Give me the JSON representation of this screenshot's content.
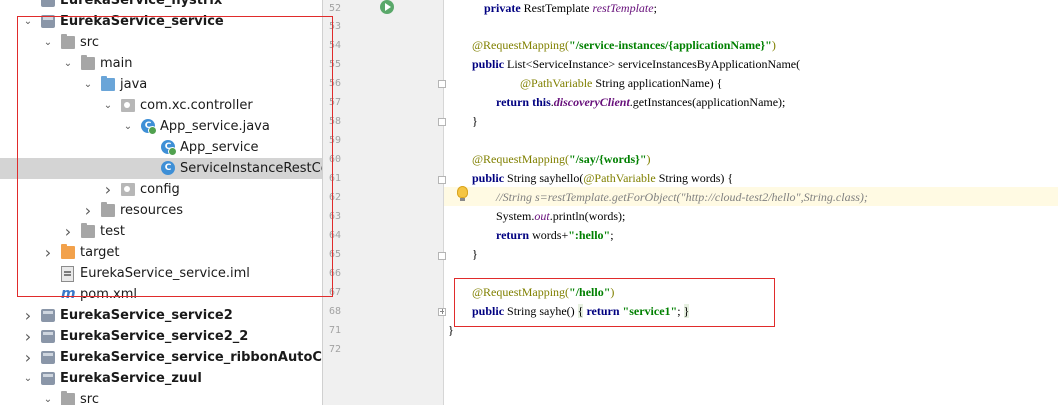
{
  "project_tree": {
    "items": [
      {
        "label": "EurekaService_hystrix",
        "bold": true,
        "arrow": "",
        "icon": "module-icon",
        "level": 0
      },
      {
        "label": "EurekaService_service",
        "bold": true,
        "arrow": "expanded",
        "icon": "module-icon",
        "level": 0
      },
      {
        "label": "src",
        "arrow": "expanded",
        "icon": "folder-icon",
        "level": 1
      },
      {
        "label": "main",
        "arrow": "expanded",
        "icon": "folder-icon",
        "level": 2
      },
      {
        "label": "java",
        "arrow": "expanded",
        "icon": "source-folder-icon",
        "level": 3
      },
      {
        "label": "com.xc.controller",
        "arrow": "expanded",
        "icon": "package-icon",
        "level": 4
      },
      {
        "label": "App_service.java",
        "arrow": "expanded",
        "icon": "java-file-icon",
        "level": 5
      },
      {
        "label": "App_service",
        "arrow": "",
        "icon": "runnable-class-icon",
        "level": 6
      },
      {
        "label": "ServiceInstanceRestCon",
        "arrow": "",
        "icon": "class-icon",
        "level": 6,
        "selected": true
      },
      {
        "label": "config",
        "arrow": "collapsed",
        "icon": "package-icon",
        "level": 4
      },
      {
        "label": "resources",
        "arrow": "collapsed",
        "icon": "folder-icon",
        "level": 3
      },
      {
        "label": "test",
        "arrow": "collapsed",
        "icon": "folder-icon",
        "level": 2
      },
      {
        "label": "target",
        "arrow": "collapsed",
        "icon": "excluded-folder-icon",
        "level": 1
      },
      {
        "label": "EurekaService_service.iml",
        "arrow": "",
        "icon": "iml-file-icon",
        "level": 1
      },
      {
        "label": "pom.xml",
        "arrow": "",
        "icon": "maven-icon",
        "level": 1
      },
      {
        "label": "EurekaService_service2",
        "bold": true,
        "arrow": "collapsed",
        "icon": "module-icon",
        "level": 0
      },
      {
        "label": "EurekaService_service2_2",
        "bold": true,
        "arrow": "collapsed",
        "icon": "module-icon",
        "level": 0
      },
      {
        "label": "EurekaService_service_ribbonAutoConfig",
        "bold": true,
        "arrow": "collapsed",
        "icon": "module-icon",
        "level": 0
      },
      {
        "label": "EurekaService_zuul",
        "bold": true,
        "arrow": "expanded",
        "icon": "module-icon",
        "level": 0
      },
      {
        "label": "src",
        "arrow": "expanded",
        "icon": "folder-icon",
        "level": 1
      }
    ]
  },
  "editor": {
    "line_numbers": [
      "52",
      "53",
      "54",
      "55",
      "56",
      "57",
      "58",
      "59",
      "60",
      "61",
      "62",
      "63",
      "64",
      "65",
      "66",
      "67",
      "68",
      "71",
      "72"
    ],
    "lines": {
      "l52": {
        "kw": "private",
        "rest": " RestTemplate ",
        "field": "restTemplate",
        "end": ";"
      },
      "l54": {
        "ann": "@RequestMapping(",
        "str": "\"/service-instances/{applicationName}\"",
        "end": ")"
      },
      "l55": {
        "kw": "public",
        "rest": " List<ServiceInstance> serviceInstancesByApplicationName("
      },
      "l56": {
        "ann": "@PathVariable",
        "rest": " String applicationName) {"
      },
      "l57": {
        "kw": "return",
        "kw2": " this",
        "dot": ".",
        "field": "discoveryClient",
        "rest": ".getInstances(applicationName);"
      },
      "l58": {
        "rest": "}"
      },
      "l60": {
        "ann": "@RequestMapping(",
        "str": "\"/say/{words}\"",
        "end": ")"
      },
      "l61": {
        "kw": "public",
        "rest": " String sayhello(",
        "ann": "@PathVariable",
        "rest2": " String words) {"
      },
      "l62": {
        "comment": "//String s=restTemplate.getForObject(\"http://cloud-test2/hello\",String.class);"
      },
      "l63": {
        "rest": "System.",
        "field": "out",
        "rest2": ".println(words);"
      },
      "l64": {
        "kw": "return",
        "rest": " words+",
        "str": "\":hello\"",
        "end": ";"
      },
      "l65": {
        "rest": "}"
      },
      "l67": {
        "ann": "@RequestMapping(",
        "str": "\"/hello\"",
        "end": ")"
      },
      "l68": {
        "kw": "public",
        "rest": " String sayhe() ",
        "brace": "{",
        "kw2": " return",
        "str": " \"service1\"",
        "end": "; ",
        "brace2": "}"
      },
      "l71": {
        "rest": "}"
      }
    }
  }
}
